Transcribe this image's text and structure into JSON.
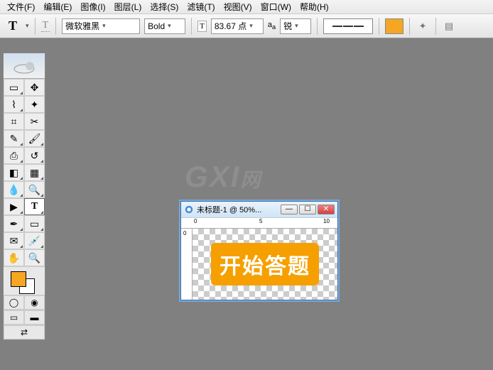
{
  "menu": {
    "file": "文件(F)",
    "edit": "编辑(E)",
    "image": "图像(I)",
    "layer": "图层(L)",
    "select": "选择(S)",
    "filter": "滤镜(T)",
    "view": "视图(V)",
    "window": "窗口(W)",
    "help": "帮助(H)"
  },
  "options": {
    "font_family": "微软雅黑",
    "font_weight": "Bold",
    "font_size": "83.67 点",
    "antialias_label": "锐",
    "color": "#f5a623"
  },
  "toolbox": {
    "fg_color": "#f5a623",
    "bg_color": "#ffffff"
  },
  "document": {
    "title": "未标题-1 @ 50%...",
    "ruler_marks": [
      "0",
      "5",
      "10"
    ],
    "button_text": "开始答题"
  },
  "watermark": {
    "main": "GXI",
    "sub": "网"
  }
}
